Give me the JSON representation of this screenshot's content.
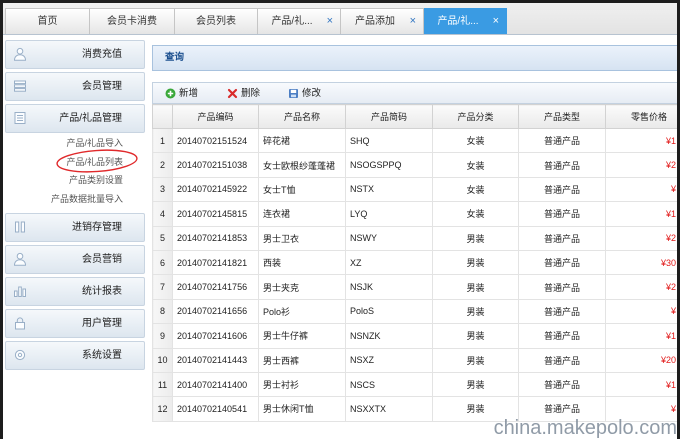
{
  "tabs": [
    {
      "label": "首页",
      "closable": false,
      "active": false
    },
    {
      "label": "会员卡消费",
      "closable": false,
      "active": false
    },
    {
      "label": "会员列表",
      "closable": false,
      "active": false
    },
    {
      "label": "产品/礼...",
      "closable": true,
      "active": false
    },
    {
      "label": "产品添加",
      "closable": true,
      "active": false
    },
    {
      "label": "产品/礼...",
      "closable": true,
      "active": true
    }
  ],
  "tab_close_glyph": "×",
  "sidebar": {
    "items": [
      {
        "label": "消费充值",
        "icon": "person-icon"
      },
      {
        "label": "会员管理",
        "icon": "members-icon"
      },
      {
        "label": "产品/礼品管理",
        "icon": "list-icon"
      },
      {
        "label": "进销存管理",
        "icon": "inventory-icon"
      },
      {
        "label": "会员营销",
        "icon": "person-icon"
      },
      {
        "label": "统计报表",
        "icon": "chart-icon"
      },
      {
        "label": "用户管理",
        "icon": "lock-icon"
      },
      {
        "label": "系统设置",
        "icon": "settings-icon"
      }
    ],
    "expanded_index": 2,
    "submenu": [
      {
        "label": "产品/礼品导入"
      },
      {
        "label": "产品/礼品列表"
      },
      {
        "label": "产品类别设置"
      },
      {
        "label": "产品数据批量导入"
      }
    ]
  },
  "query_panel": {
    "title": "查询"
  },
  "toolbar": {
    "add_label": "新增",
    "delete_label": "删除",
    "edit_label": "修改"
  },
  "table": {
    "headers": [
      "产品编码",
      "产品名称",
      "产品简码",
      "产品分类",
      "产品类型",
      "零售价格"
    ],
    "rows": [
      {
        "index": "1",
        "code": "20140702151524",
        "name": "碎花裙",
        "abbr": "SHQ",
        "category": "女装",
        "type": "普通产品",
        "price": "¥1"
      },
      {
        "index": "2",
        "code": "20140702151038",
        "name": "女士欧根纱蓬蓬裙",
        "abbr": "NSOGSPPQ",
        "category": "女装",
        "type": "普通产品",
        "price": "¥2"
      },
      {
        "index": "3",
        "code": "20140702145922",
        "name": "女士T恤",
        "abbr": "NSTX",
        "category": "女装",
        "type": "普通产品",
        "price": "¥"
      },
      {
        "index": "4",
        "code": "20140702145815",
        "name": "连衣裙",
        "abbr": "LYQ",
        "category": "女装",
        "type": "普通产品",
        "price": "¥1"
      },
      {
        "index": "5",
        "code": "20140702141853",
        "name": "男士卫衣",
        "abbr": "NSWY",
        "category": "男装",
        "type": "普通产品",
        "price": "¥2"
      },
      {
        "index": "6",
        "code": "20140702141821",
        "name": "西装",
        "abbr": "XZ",
        "category": "男装",
        "type": "普通产品",
        "price": "¥30"
      },
      {
        "index": "7",
        "code": "20140702141756",
        "name": "男士夹克",
        "abbr": "NSJK",
        "category": "男装",
        "type": "普通产品",
        "price": "¥2"
      },
      {
        "index": "8",
        "code": "20140702141656",
        "name": "Polo衫",
        "abbr": "PoloS",
        "category": "男装",
        "type": "普通产品",
        "price": "¥"
      },
      {
        "index": "9",
        "code": "20140702141606",
        "name": "男士牛仔裤",
        "abbr": "NSNZK",
        "category": "男装",
        "type": "普通产品",
        "price": "¥1"
      },
      {
        "index": "10",
        "code": "20140702141443",
        "name": "男士西裤",
        "abbr": "NSXZ",
        "category": "男装",
        "type": "普通产品",
        "price": "¥20"
      },
      {
        "index": "11",
        "code": "20140702141400",
        "name": "男士衬衫",
        "abbr": "NSCS",
        "category": "男装",
        "type": "普通产品",
        "price": "¥1"
      },
      {
        "index": "12",
        "code": "20140702140541",
        "name": "男士休闲T恤",
        "abbr": "NSXXTX",
        "category": "男装",
        "type": "普通产品",
        "price": "¥"
      }
    ]
  },
  "watermark": "china.makepolo.com",
  "colors": {
    "active_tab": "#3a9be3",
    "price_text": "#e21b1b",
    "highlight_circle": "#e0292b"
  }
}
